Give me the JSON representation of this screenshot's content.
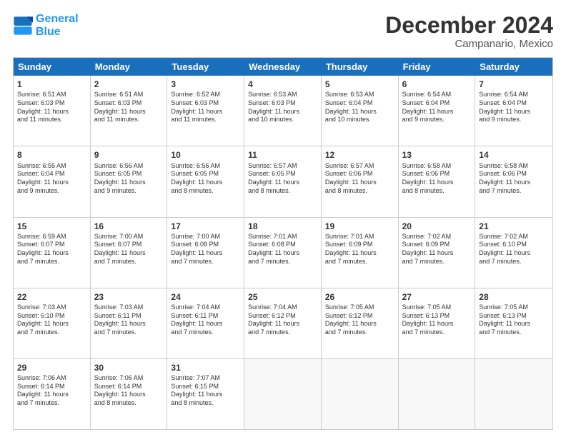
{
  "header": {
    "logo_line1": "General",
    "logo_line2": "Blue",
    "title": "December 2024",
    "subtitle": "Campanario, Mexico"
  },
  "days_of_week": [
    "Sunday",
    "Monday",
    "Tuesday",
    "Wednesday",
    "Thursday",
    "Friday",
    "Saturday"
  ],
  "weeks": [
    [
      {
        "day": "1",
        "info": "Sunrise: 6:51 AM\nSunset: 6:03 PM\nDaylight: 11 hours\nand 11 minutes."
      },
      {
        "day": "2",
        "info": "Sunrise: 6:51 AM\nSunset: 6:03 PM\nDaylight: 11 hours\nand 11 minutes."
      },
      {
        "day": "3",
        "info": "Sunrise: 6:52 AM\nSunset: 6:03 PM\nDaylight: 11 hours\nand 11 minutes."
      },
      {
        "day": "4",
        "info": "Sunrise: 6:53 AM\nSunset: 6:03 PM\nDaylight: 11 hours\nand 10 minutes."
      },
      {
        "day": "5",
        "info": "Sunrise: 6:53 AM\nSunset: 6:04 PM\nDaylight: 11 hours\nand 10 minutes."
      },
      {
        "day": "6",
        "info": "Sunrise: 6:54 AM\nSunset: 6:04 PM\nDaylight: 11 hours\nand 9 minutes."
      },
      {
        "day": "7",
        "info": "Sunrise: 6:54 AM\nSunset: 6:04 PM\nDaylight: 11 hours\nand 9 minutes."
      }
    ],
    [
      {
        "day": "8",
        "info": "Sunrise: 6:55 AM\nSunset: 6:04 PM\nDaylight: 11 hours\nand 9 minutes."
      },
      {
        "day": "9",
        "info": "Sunrise: 6:56 AM\nSunset: 6:05 PM\nDaylight: 11 hours\nand 9 minutes."
      },
      {
        "day": "10",
        "info": "Sunrise: 6:56 AM\nSunset: 6:05 PM\nDaylight: 11 hours\nand 8 minutes."
      },
      {
        "day": "11",
        "info": "Sunrise: 6:57 AM\nSunset: 6:05 PM\nDaylight: 11 hours\nand 8 minutes."
      },
      {
        "day": "12",
        "info": "Sunrise: 6:57 AM\nSunset: 6:06 PM\nDaylight: 11 hours\nand 8 minutes."
      },
      {
        "day": "13",
        "info": "Sunrise: 6:58 AM\nSunset: 6:06 PM\nDaylight: 11 hours\nand 8 minutes."
      },
      {
        "day": "14",
        "info": "Sunrise: 6:58 AM\nSunset: 6:06 PM\nDaylight: 11 hours\nand 7 minutes."
      }
    ],
    [
      {
        "day": "15",
        "info": "Sunrise: 6:59 AM\nSunset: 6:07 PM\nDaylight: 11 hours\nand 7 minutes."
      },
      {
        "day": "16",
        "info": "Sunrise: 7:00 AM\nSunset: 6:07 PM\nDaylight: 11 hours\nand 7 minutes."
      },
      {
        "day": "17",
        "info": "Sunrise: 7:00 AM\nSunset: 6:08 PM\nDaylight: 11 hours\nand 7 minutes."
      },
      {
        "day": "18",
        "info": "Sunrise: 7:01 AM\nSunset: 6:08 PM\nDaylight: 11 hours\nand 7 minutes."
      },
      {
        "day": "19",
        "info": "Sunrise: 7:01 AM\nSunset: 6:09 PM\nDaylight: 11 hours\nand 7 minutes."
      },
      {
        "day": "20",
        "info": "Sunrise: 7:02 AM\nSunset: 6:09 PM\nDaylight: 11 hours\nand 7 minutes."
      },
      {
        "day": "21",
        "info": "Sunrise: 7:02 AM\nSunset: 6:10 PM\nDaylight: 11 hours\nand 7 minutes."
      }
    ],
    [
      {
        "day": "22",
        "info": "Sunrise: 7:03 AM\nSunset: 6:10 PM\nDaylight: 11 hours\nand 7 minutes."
      },
      {
        "day": "23",
        "info": "Sunrise: 7:03 AM\nSunset: 6:11 PM\nDaylight: 11 hours\nand 7 minutes."
      },
      {
        "day": "24",
        "info": "Sunrise: 7:04 AM\nSunset: 6:11 PM\nDaylight: 11 hours\nand 7 minutes."
      },
      {
        "day": "25",
        "info": "Sunrise: 7:04 AM\nSunset: 6:12 PM\nDaylight: 11 hours\nand 7 minutes."
      },
      {
        "day": "26",
        "info": "Sunrise: 7:05 AM\nSunset: 6:12 PM\nDaylight: 11 hours\nand 7 minutes."
      },
      {
        "day": "27",
        "info": "Sunrise: 7:05 AM\nSunset: 6:13 PM\nDaylight: 11 hours\nand 7 minutes."
      },
      {
        "day": "28",
        "info": "Sunrise: 7:05 AM\nSunset: 6:13 PM\nDaylight: 11 hours\nand 7 minutes."
      }
    ],
    [
      {
        "day": "29",
        "info": "Sunrise: 7:06 AM\nSunset: 6:14 PM\nDaylight: 11 hours\nand 7 minutes."
      },
      {
        "day": "30",
        "info": "Sunrise: 7:06 AM\nSunset: 6:14 PM\nDaylight: 11 hours\nand 8 minutes."
      },
      {
        "day": "31",
        "info": "Sunrise: 7:07 AM\nSunset: 6:15 PM\nDaylight: 11 hours\nand 8 minutes."
      },
      {
        "day": "",
        "info": ""
      },
      {
        "day": "",
        "info": ""
      },
      {
        "day": "",
        "info": ""
      },
      {
        "day": "",
        "info": ""
      }
    ]
  ]
}
